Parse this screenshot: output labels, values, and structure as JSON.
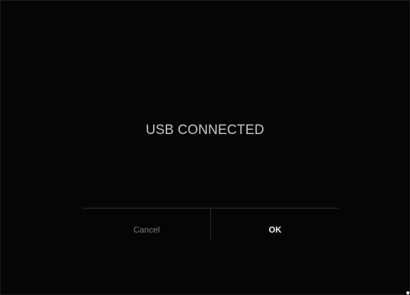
{
  "dialog": {
    "message": "USB CONNECTED",
    "cancel_label": "Cancel",
    "ok_label": "OK"
  },
  "colors": {
    "background": "#050505",
    "message_text": "#c9c9c9",
    "cancel_text": "#7d7d7d",
    "ok_text": "#f2f2f2",
    "divider": "#2f2f2f"
  }
}
